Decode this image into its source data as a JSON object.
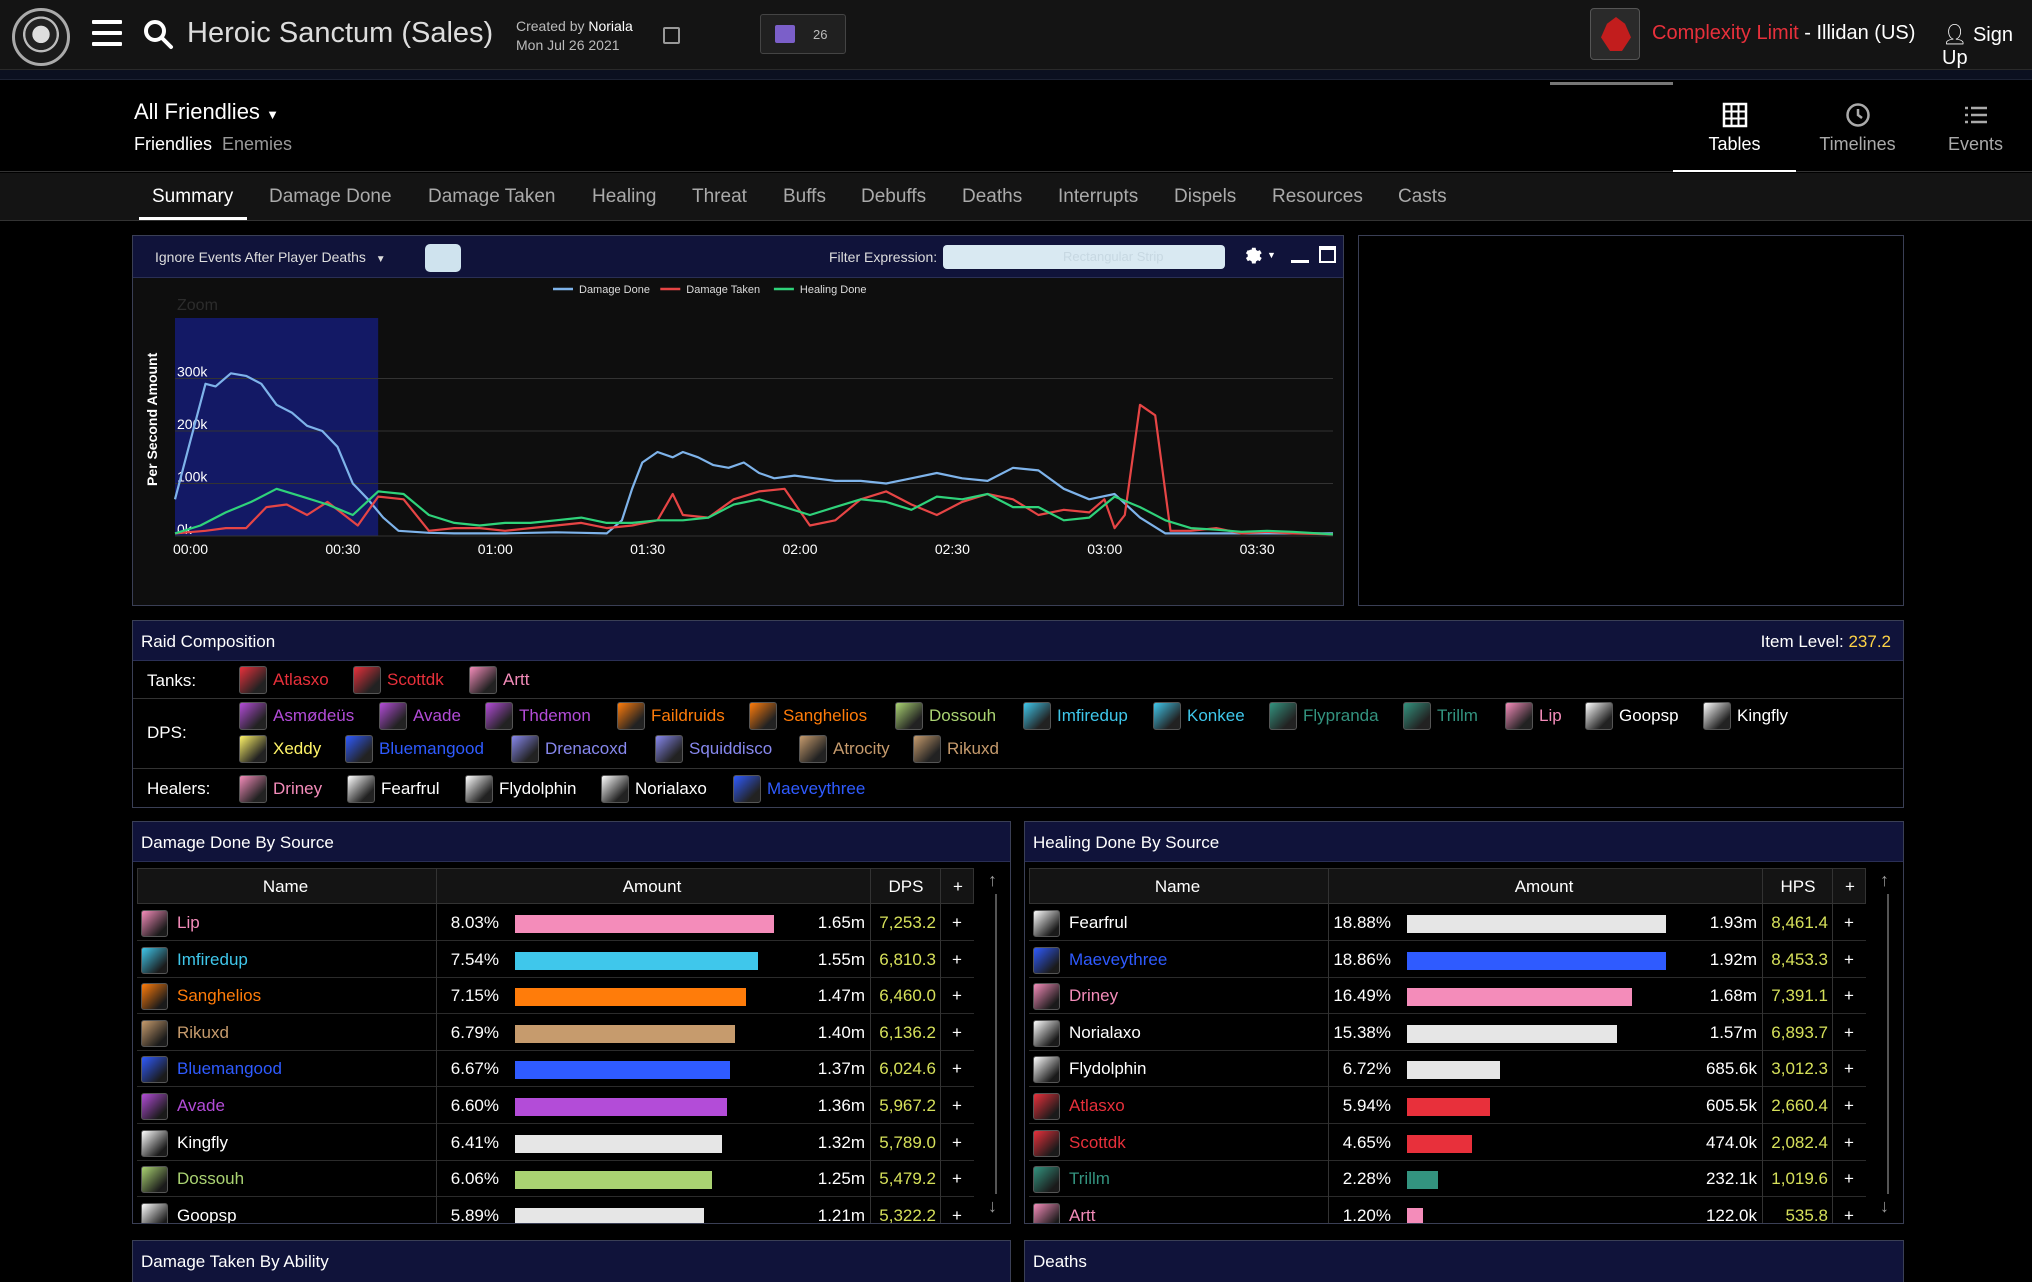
{
  "header": {
    "title": "Heroic Sanctum (Sales)",
    "created_by_label": "Created by",
    "created_by": "Noriala",
    "date": "Mon Jul 26 2021",
    "twitch_count": "26",
    "guild_name": "Complexity Limit",
    "guild_sep": " - ",
    "realm": "Illidan (US)",
    "signup": "Sign Up"
  },
  "filter": {
    "dropdown": "All Friendlies",
    "friendlies": "Friendlies",
    "enemies": "Enemies"
  },
  "view_tabs": [
    {
      "label": "Tables",
      "icon": "table-icon"
    },
    {
      "label": "Timelines",
      "icon": "clock-icon"
    },
    {
      "label": "Events",
      "icon": "list-icon"
    }
  ],
  "main_tabs": [
    "Summary",
    "Damage Done",
    "Damage Taken",
    "Healing",
    "Threat",
    "Buffs",
    "Debuffs",
    "Deaths",
    "Interrupts",
    "Dispels",
    "Resources",
    "Casts"
  ],
  "graph_panel": {
    "ignore_label": "Ignore Events After Player Deaths",
    "filter_label": "Filter Expression:",
    "filter_placeholder": "Rectangular Strip"
  },
  "chart_data": {
    "type": "line",
    "ylabel": "Per Second Amount",
    "zoom_label": "Zoom",
    "x_ticks": [
      "00:00",
      "00:30",
      "01:00",
      "01:30",
      "02:00",
      "02:30",
      "03:00",
      "03:30"
    ],
    "y_ticks": [
      "0k",
      "100k",
      "200k",
      "300k"
    ],
    "ylim": [
      0,
      400000
    ],
    "xlim": [
      0,
      228
    ],
    "selection": [
      0,
      40
    ],
    "series": [
      {
        "name": "Damage Done",
        "color": "#7eb3ea",
        "x": [
          0,
          3,
          6,
          8,
          11,
          14,
          17,
          20,
          23,
          26,
          29,
          32,
          35,
          38,
          41,
          44,
          47,
          50,
          55,
          60,
          65,
          70,
          75,
          80,
          85,
          88,
          90,
          92,
          95,
          98,
          100,
          103,
          106,
          109,
          112,
          115,
          118,
          122,
          126,
          130,
          135,
          140,
          145,
          150,
          155,
          160,
          165,
          170,
          175,
          180,
          185,
          190,
          195,
          198,
          201,
          205,
          210,
          215,
          220,
          225,
          228
        ],
        "y": [
          70000,
          180000,
          290000,
          285000,
          310000,
          305000,
          290000,
          250000,
          235000,
          210000,
          200000,
          170000,
          100000,
          70000,
          35000,
          10000,
          8000,
          6000,
          5000,
          5000,
          5000,
          6000,
          7000,
          6000,
          5000,
          30000,
          90000,
          140000,
          160000,
          150000,
          160000,
          150000,
          135000,
          130000,
          140000,
          120000,
          110000,
          115000,
          110000,
          105000,
          105000,
          100000,
          110000,
          120000,
          110000,
          105000,
          130000,
          125000,
          90000,
          70000,
          80000,
          35000,
          5000,
          5000,
          5000,
          5000,
          5000,
          5000,
          5000,
          5000,
          5000
        ]
      },
      {
        "name": "Damage Taken",
        "color": "#e64545",
        "x": [
          0,
          6,
          10,
          14,
          18,
          22,
          26,
          30,
          36,
          40,
          45,
          50,
          55,
          60,
          65,
          70,
          75,
          80,
          85,
          90,
          95,
          98,
          100,
          105,
          110,
          115,
          120,
          125,
          130,
          135,
          140,
          145,
          150,
          155,
          160,
          165,
          170,
          175,
          180,
          183,
          185,
          187,
          190,
          193,
          196,
          200,
          205,
          210,
          215,
          220,
          225,
          228
        ],
        "y": [
          5000,
          10000,
          15000,
          15000,
          55000,
          60000,
          40000,
          65000,
          20000,
          75000,
          70000,
          10000,
          15000,
          15000,
          10000,
          15000,
          20000,
          25000,
          15000,
          20000,
          30000,
          80000,
          40000,
          35000,
          70000,
          85000,
          90000,
          20000,
          30000,
          70000,
          85000,
          60000,
          40000,
          65000,
          80000,
          70000,
          40000,
          50000,
          45000,
          70000,
          15000,
          40000,
          250000,
          230000,
          10000,
          10000,
          15000,
          5000,
          8000,
          5000,
          4000,
          3000
        ]
      },
      {
        "name": "Healing Done",
        "color": "#2fd27a",
        "x": [
          0,
          5,
          10,
          15,
          20,
          25,
          30,
          35,
          40,
          45,
          50,
          55,
          60,
          65,
          70,
          75,
          80,
          85,
          90,
          95,
          100,
          105,
          110,
          115,
          120,
          125,
          130,
          135,
          140,
          145,
          150,
          155,
          160,
          165,
          170,
          175,
          180,
          185,
          190,
          195,
          200,
          205,
          210,
          215,
          220,
          225,
          228
        ],
        "y": [
          5000,
          20000,
          45000,
          65000,
          90000,
          75000,
          60000,
          40000,
          85000,
          80000,
          40000,
          25000,
          20000,
          25000,
          25000,
          30000,
          35000,
          25000,
          25000,
          30000,
          30000,
          35000,
          60000,
          70000,
          55000,
          40000,
          55000,
          70000,
          65000,
          50000,
          75000,
          70000,
          80000,
          55000,
          55000,
          30000,
          35000,
          75000,
          55000,
          30000,
          15000,
          12000,
          8000,
          10000,
          8000,
          5000,
          3000
        ]
      }
    ]
  },
  "raid": {
    "title": "Raid Composition",
    "item_level_label": "Item Level:",
    "item_level": "237.2",
    "tanks_label": "Tanks:",
    "dps_label": "DPS:",
    "healers_label": "Healers:",
    "tanks": [
      {
        "name": "Atlasxo",
        "color": "#e8303b",
        "icon": "death-knight-icon"
      },
      {
        "name": "Scottdk",
        "color": "#e8303b",
        "icon": "death-knight-icon"
      },
      {
        "name": "Artt",
        "color": "#f48cba",
        "icon": "paladin-icon"
      }
    ],
    "dps": [
      {
        "name": "Asmødeüs",
        "color": "#b34cd8",
        "icon": "demon-hunter-icon"
      },
      {
        "name": "Avade",
        "color": "#b34cd8",
        "icon": "demon-hunter-icon"
      },
      {
        "name": "Thdemon",
        "color": "#b34cd8",
        "icon": "demon-hunter-icon"
      },
      {
        "name": "Faildruids",
        "color": "#ff7c0a",
        "icon": "druid-icon"
      },
      {
        "name": "Sanghelios",
        "color": "#ff7c0a",
        "icon": "druid-icon"
      },
      {
        "name": "Dossouh",
        "color": "#aad372",
        "icon": "hunter-icon"
      },
      {
        "name": "Imfiredup",
        "color": "#3fc7eb",
        "icon": "mage-icon"
      },
      {
        "name": "Konkee",
        "color": "#3fc7eb",
        "icon": "mage-icon"
      },
      {
        "name": "Flypranda",
        "color": "#33937f",
        "icon": "monk-icon"
      },
      {
        "name": "Trillm",
        "color": "#33937f",
        "icon": "monk-icon"
      },
      {
        "name": "Lip",
        "color": "#f48cba",
        "icon": "paladin-icon"
      },
      {
        "name": "Goopsp",
        "color": "#ffffff",
        "icon": "priest-icon"
      },
      {
        "name": "Kingfly",
        "color": "#ffffff",
        "icon": "priest-icon"
      },
      {
        "name": "Xeddy",
        "color": "#fff468",
        "icon": "rogue-icon"
      },
      {
        "name": "Bluemangood",
        "color": "#2f5bff",
        "icon": "shaman-icon"
      },
      {
        "name": "Drenacoxd",
        "color": "#8788ee",
        "icon": "warlock-icon"
      },
      {
        "name": "Squiddisco",
        "color": "#8788ee",
        "icon": "warlock-icon"
      },
      {
        "name": "Atrocity",
        "color": "#c69b6d",
        "icon": "warrior-icon"
      },
      {
        "name": "Rikuxd",
        "color": "#c69b6d",
        "icon": "warrior-icon"
      }
    ],
    "healers": [
      {
        "name": "Driney",
        "color": "#f48cba",
        "icon": "holy-paladin-icon"
      },
      {
        "name": "Fearfrul",
        "color": "#ffffff",
        "icon": "holy-priest-icon"
      },
      {
        "name": "Flydolphin",
        "color": "#ffffff",
        "icon": "holy-priest-icon"
      },
      {
        "name": "Norialaxo",
        "color": "#ffffff",
        "icon": "holy-priest-icon"
      },
      {
        "name": "Maeveythree",
        "color": "#2f5bff",
        "icon": "restoration-shaman-icon"
      }
    ]
  },
  "damage_table": {
    "title": "Damage Done By Source",
    "col_name": "Name",
    "col_amount": "Amount",
    "col_rate": "DPS",
    "col_plus": "+",
    "rows": [
      {
        "name": "Lip",
        "color": "#f48cba",
        "pct": "8.03%",
        "frac": 1.0,
        "amount": "1.65m",
        "rate": "7,253.2"
      },
      {
        "name": "Imfiredup",
        "color": "#3fc7eb",
        "pct": "7.54%",
        "frac": 0.94,
        "amount": "1.55m",
        "rate": "6,810.3"
      },
      {
        "name": "Sanghelios",
        "color": "#ff7c0a",
        "pct": "7.15%",
        "frac": 0.89,
        "amount": "1.47m",
        "rate": "6,460.0"
      },
      {
        "name": "Rikuxd",
        "color": "#c69b6d",
        "pct": "6.79%",
        "frac": 0.85,
        "amount": "1.40m",
        "rate": "6,136.2"
      },
      {
        "name": "Bluemangood",
        "color": "#2f5bff",
        "pct": "6.67%",
        "frac": 0.83,
        "amount": "1.37m",
        "rate": "6,024.6"
      },
      {
        "name": "Avade",
        "color": "#b34cd8",
        "pct": "6.60%",
        "frac": 0.82,
        "amount": "1.36m",
        "rate": "5,967.2"
      },
      {
        "name": "Kingfly",
        "color": "#ffffff",
        "pct": "6.41%",
        "frac": 0.8,
        "amount": "1.32m",
        "rate": "5,789.0"
      },
      {
        "name": "Dossouh",
        "color": "#aad372",
        "pct": "6.06%",
        "frac": 0.76,
        "amount": "1.25m",
        "rate": "5,479.2"
      },
      {
        "name": "Goopsp",
        "color": "#ffffff",
        "pct": "5.89%",
        "frac": 0.73,
        "amount": "1.21m",
        "rate": "5,322.2"
      }
    ]
  },
  "healing_table": {
    "title": "Healing Done By Source",
    "col_name": "Name",
    "col_amount": "Amount",
    "col_rate": "HPS",
    "col_plus": "+",
    "rows": [
      {
        "name": "Fearfrul",
        "color": "#ffffff",
        "pct": "18.88%",
        "frac": 1.0,
        "amount": "1.93m",
        "rate": "8,461.4"
      },
      {
        "name": "Maeveythree",
        "color": "#2f5bff",
        "pct": "18.86%",
        "frac": 1.0,
        "amount": "1.92m",
        "rate": "8,453.3"
      },
      {
        "name": "Driney",
        "color": "#f48cba",
        "pct": "16.49%",
        "frac": 0.87,
        "amount": "1.68m",
        "rate": "7,391.1"
      },
      {
        "name": "Norialaxo",
        "color": "#ffffff",
        "pct": "15.38%",
        "frac": 0.81,
        "amount": "1.57m",
        "rate": "6,893.7"
      },
      {
        "name": "Flydolphin",
        "color": "#ffffff",
        "pct": "6.72%",
        "frac": 0.36,
        "amount": "685.6k",
        "rate": "3,012.3"
      },
      {
        "name": "Atlasxo",
        "color": "#e8303b",
        "pct": "5.94%",
        "frac": 0.32,
        "amount": "605.5k",
        "rate": "2,660.4"
      },
      {
        "name": "Scottdk",
        "color": "#e8303b",
        "pct": "4.65%",
        "frac": 0.25,
        "amount": "474.0k",
        "rate": "2,082.4"
      },
      {
        "name": "Trillm",
        "color": "#33937f",
        "pct": "2.28%",
        "frac": 0.12,
        "amount": "232.1k",
        "rate": "1,019.6"
      },
      {
        "name": "Artt",
        "color": "#f48cba",
        "pct": "1.20%",
        "frac": 0.06,
        "amount": "122.0k",
        "rate": "535.8"
      }
    ]
  },
  "bottom": {
    "damage_taken_title": "Damage Taken By Ability",
    "deaths_title": "Deaths"
  },
  "colors": {
    "panel_header": "#10133a",
    "rate_value": "#d6e05a",
    "accent_red": "#e8303b"
  }
}
